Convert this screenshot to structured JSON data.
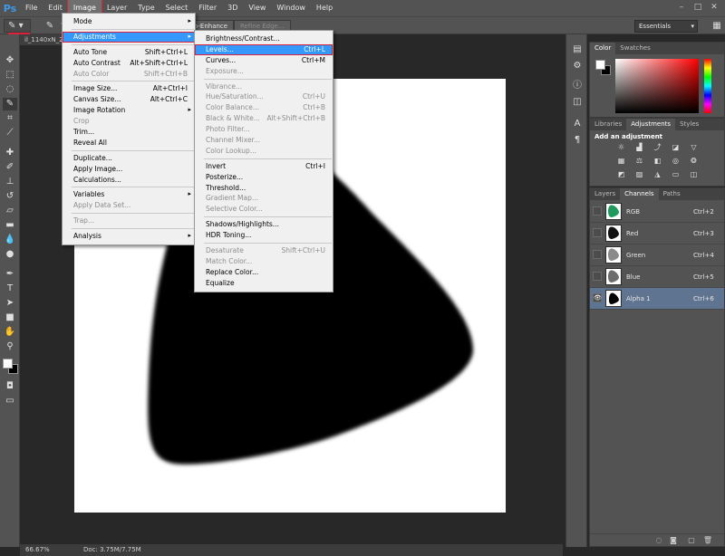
{
  "app": {
    "logo": "Ps"
  },
  "menubar": {
    "items": [
      "File",
      "Edit",
      "Image",
      "Layer",
      "Type",
      "Select",
      "Filter",
      "3D",
      "View",
      "Window",
      "Help"
    ],
    "active": "Image"
  },
  "optionsbar": {
    "auto_enhance": "Auto-Enhance",
    "refine_edge": "Refine Edge...",
    "workspace": "Essentials"
  },
  "document": {
    "tab_title": "il_1140xN_2",
    "zoom": "66.67%",
    "doc_info": "Doc: 3.75M/7.75M"
  },
  "image_menu": {
    "items": [
      {
        "label": "Mode",
        "submenu": true
      },
      {
        "sep": true
      },
      {
        "label": "Adjustments",
        "submenu": true,
        "highlight": "red"
      },
      {
        "sep": true
      },
      {
        "label": "Auto Tone",
        "shortcut": "Shift+Ctrl+L"
      },
      {
        "label": "Auto Contrast",
        "shortcut": "Alt+Shift+Ctrl+L"
      },
      {
        "label": "Auto Color",
        "shortcut": "Shift+Ctrl+B",
        "disabled": true
      },
      {
        "sep": true
      },
      {
        "label": "Image Size...",
        "shortcut": "Alt+Ctrl+I"
      },
      {
        "label": "Canvas Size...",
        "shortcut": "Alt+Ctrl+C"
      },
      {
        "label": "Image Rotation",
        "submenu": true
      },
      {
        "label": "Crop",
        "disabled": true
      },
      {
        "label": "Trim..."
      },
      {
        "label": "Reveal All"
      },
      {
        "sep": true
      },
      {
        "label": "Duplicate..."
      },
      {
        "label": "Apply Image..."
      },
      {
        "label": "Calculations..."
      },
      {
        "sep": true
      },
      {
        "label": "Variables",
        "submenu": true
      },
      {
        "label": "Apply Data Set...",
        "disabled": true
      },
      {
        "sep": true
      },
      {
        "label": "Trap...",
        "disabled": true
      },
      {
        "sep": true
      },
      {
        "label": "Analysis",
        "submenu": true
      }
    ]
  },
  "adjustments_menu": {
    "items": [
      {
        "label": "Brightness/Contrast..."
      },
      {
        "label": "Levels...",
        "shortcut": "Ctrl+L",
        "highlight": "red"
      },
      {
        "label": "Curves...",
        "shortcut": "Ctrl+M"
      },
      {
        "label": "Exposure...",
        "disabled": true
      },
      {
        "sep": true
      },
      {
        "label": "Vibrance...",
        "disabled": true
      },
      {
        "label": "Hue/Saturation...",
        "shortcut": "Ctrl+U",
        "disabled": true
      },
      {
        "label": "Color Balance...",
        "shortcut": "Ctrl+B",
        "disabled": true
      },
      {
        "label": "Black & White...",
        "shortcut": "Alt+Shift+Ctrl+B",
        "disabled": true
      },
      {
        "label": "Photo Filter...",
        "disabled": true
      },
      {
        "label": "Channel Mixer...",
        "disabled": true
      },
      {
        "label": "Color Lookup...",
        "disabled": true
      },
      {
        "sep": true
      },
      {
        "label": "Invert",
        "shortcut": "Ctrl+I"
      },
      {
        "label": "Posterize..."
      },
      {
        "label": "Threshold..."
      },
      {
        "label": "Gradient Map...",
        "disabled": true
      },
      {
        "label": "Selective Color...",
        "disabled": true
      },
      {
        "sep": true
      },
      {
        "label": "Shadows/Highlights..."
      },
      {
        "label": "HDR Toning..."
      },
      {
        "sep": true
      },
      {
        "label": "Desaturate",
        "shortcut": "Shift+Ctrl+U",
        "disabled": true
      },
      {
        "label": "Match Color...",
        "disabled": true
      },
      {
        "label": "Replace Color..."
      },
      {
        "label": "Equalize"
      }
    ]
  },
  "panels": {
    "color_tabs": [
      "Color",
      "Swatches"
    ],
    "adj_tabs": [
      "Libraries",
      "Adjustments",
      "Styles"
    ],
    "adj_title": "Add an adjustment",
    "channel_tabs": [
      "Layers",
      "Channels",
      "Paths"
    ],
    "channels": [
      {
        "name": "RGB",
        "shortcut": "Ctrl+2",
        "visible": false,
        "selected": false,
        "thumb": "rgb"
      },
      {
        "name": "Red",
        "shortcut": "Ctrl+3",
        "visible": false,
        "selected": false,
        "thumb": "red"
      },
      {
        "name": "Green",
        "shortcut": "Ctrl+4",
        "visible": false,
        "selected": false,
        "thumb": "green"
      },
      {
        "name": "Blue",
        "shortcut": "Ctrl+5",
        "visible": false,
        "selected": false,
        "thumb": "blue"
      },
      {
        "name": "Alpha 1",
        "shortcut": "Ctrl+6",
        "visible": true,
        "selected": true,
        "thumb": "alpha"
      }
    ]
  },
  "colors": {
    "accent_highlight": "#3399ff",
    "red_outline": "#e0203a",
    "selected_channel": "#5f7491"
  }
}
